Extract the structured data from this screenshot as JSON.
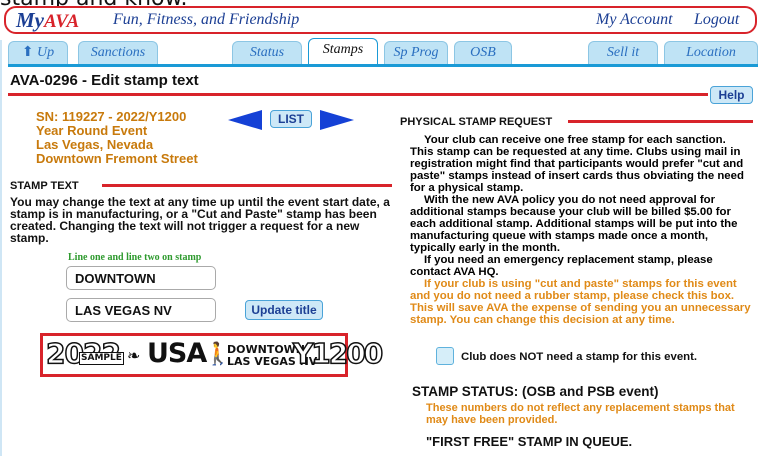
{
  "clipped_heading": "stamp and know.",
  "header": {
    "logo_main": "My",
    "logo_accent": "AVA",
    "tagline": "Fun, Fitness, and Friendship",
    "my_account": "My Account",
    "logout": "Logout"
  },
  "tabs": [
    {
      "label": "Up",
      "icon": "up-arrow-icon"
    },
    {
      "label": "Sanctions"
    },
    {
      "label": "Status"
    },
    {
      "label": "Stamps",
      "active": true
    },
    {
      "label": "Sp Prog"
    },
    {
      "label": "OSB"
    },
    {
      "label": "Sell it"
    },
    {
      "label": "Location"
    }
  ],
  "page": {
    "title": "AVA-0296 - Edit stamp text",
    "help": "Help"
  },
  "event": {
    "line1": "SN: 119227 - 2022/Y1200",
    "line2": "Year Round Event",
    "line3": "Las Vegas, Nevada",
    "line4": "Downtown Fremont Street",
    "list": "LIST"
  },
  "stamp_text": {
    "heading": "STAMP TEXT",
    "body": "You may change the text at any time up until the event start date, a stamp is in manufacturing, or a \"Cut and Paste\" stamp has been created. Changing the text will not trigger a request for a new stamp.",
    "field_label": "Line one and line two on stamp",
    "line1": "DOWNTOWN",
    "line2": "LAS VEGAS NV",
    "update": "Update title"
  },
  "stamp_image": {
    "year": "2022",
    "sample": "SAMPLE",
    "usa": "USA",
    "line1": "DOWNTOWN",
    "line2": "LAS VEGAS NV",
    "code": "Y1200"
  },
  "physical": {
    "heading": "PHYSICAL STAMP REQUEST",
    "p1": "Your club can receive one free stamp for each sanction. This stamp can be requested at any time. Clubs using mail in registration might find that participants would prefer \"cut and paste\" stamps instead of insert cards thus obviating the need for a physical stamp.",
    "p2": "With the new AVA policy you do not need approval for additional stamps because your club will be billed $5.00 for each additional stamp. Additional stamps will be put into the manufacturing queue with stamps made once a month, typically early in the month.",
    "p3": "If you need an emergency replacement stamp, please contact AVA HQ.",
    "p4": "If your club is using \"cut and paste\" stamps for this event and you do not need a rubber stamp, please check this box. This will save AVA the expense of sending you an unnecessary stamp. You can change this decision at any time.",
    "checkbox_label": "Club does NOT need a stamp for this event."
  },
  "status": {
    "heading": "STAMP STATUS: (OSB and PSB event)",
    "note": "These numbers do not reflect any replacement stamps that may have been provided.",
    "queue": "\"FIRST FREE\" STAMP IN QUEUE."
  }
}
